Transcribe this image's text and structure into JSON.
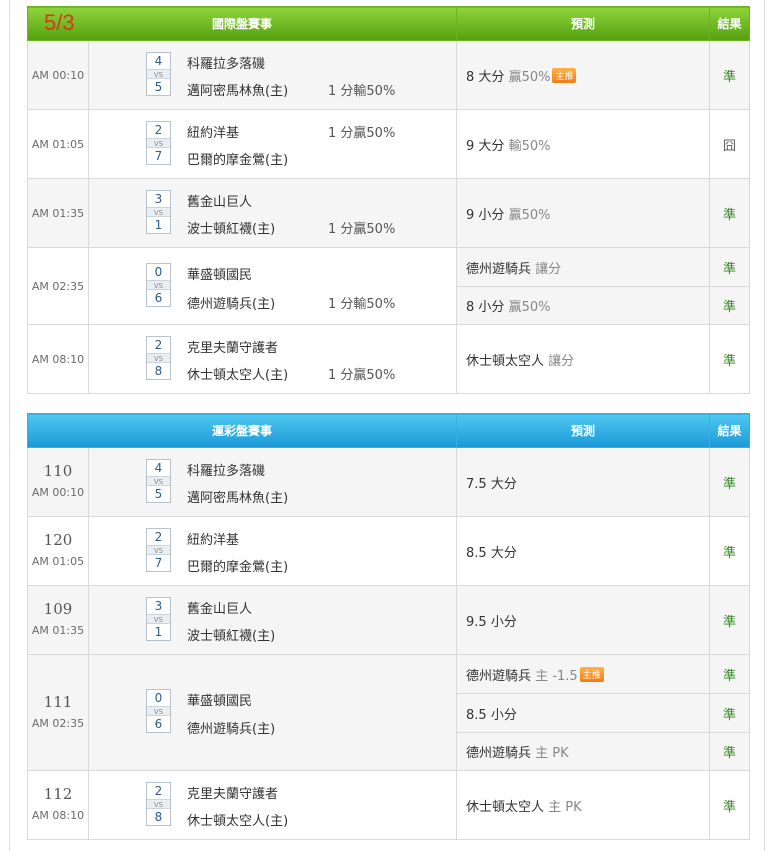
{
  "date": "5/3",
  "colors": {
    "green_header": "#6cb31f",
    "blue_header": "#1b98d8",
    "win": "#2f8a1f",
    "date": "#d13b1b",
    "tag": "#f07d16"
  },
  "table1": {
    "headers": {
      "event": "國際盤賽事",
      "pred": "預測",
      "result": "結果"
    },
    "rows": [
      {
        "time": "AM 00:10",
        "s1": "4",
        "s2": "5",
        "t1": "科羅拉多落磯",
        "t2": "邁阿密馬林魚(主)",
        "line": "1 分輸50%",
        "line_row": 2,
        "preds": [
          {
            "main": "8 大分",
            "sub": "贏50%",
            "tag": "主推",
            "result": "準"
          }
        ]
      },
      {
        "time": "AM 01:05",
        "s1": "2",
        "s2": "7",
        "t1": "紐約洋基",
        "t2": "巴爾的摩金鶯(主)",
        "line": "1 分贏50%",
        "line_row": 1,
        "preds": [
          {
            "main": "9 大分",
            "sub": "輸50%",
            "tag": "",
            "result": "囧"
          }
        ]
      },
      {
        "time": "AM 01:35",
        "s1": "3",
        "s2": "1",
        "t1": "舊金山巨人",
        "t2": "波士頓紅襪(主)",
        "line": "1 分贏50%",
        "line_row": 2,
        "preds": [
          {
            "main": "9 小分",
            "sub": "贏50%",
            "tag": "",
            "result": "準"
          }
        ]
      },
      {
        "time": "AM 02:35",
        "s1": "0",
        "s2": "6",
        "t1": "華盛頓國民",
        "t2": "德州遊騎兵(主)",
        "line": "1 分輸50%",
        "line_row": 2,
        "preds": [
          {
            "main": "德州遊騎兵",
            "sub": "讓分",
            "tag": "",
            "result": "準"
          },
          {
            "main": "8 小分",
            "sub": "贏50%",
            "tag": "",
            "result": "準"
          }
        ]
      },
      {
        "time": "AM 08:10",
        "s1": "2",
        "s2": "8",
        "t1": "克里夫蘭守護者",
        "t2": "休士頓太空人(主)",
        "line": "1 分贏50%",
        "line_row": 2,
        "preds": [
          {
            "main": "休士頓太空人",
            "sub": "讓分",
            "tag": "",
            "result": "準"
          }
        ]
      }
    ]
  },
  "table2": {
    "headers": {
      "event": "運彩盤賽事",
      "pred": "預測",
      "result": "結果"
    },
    "rows": [
      {
        "gid": "110",
        "time": "AM 00:10",
        "s1": "4",
        "s2": "5",
        "t1": "科羅拉多落磯",
        "t2": "邁阿密馬林魚(主)",
        "preds": [
          {
            "main": "7.5 大分",
            "sub": "",
            "tag": "",
            "result": "準"
          }
        ]
      },
      {
        "gid": "120",
        "time": "AM 01:05",
        "s1": "2",
        "s2": "7",
        "t1": "紐約洋基",
        "t2": "巴爾的摩金鶯(主)",
        "preds": [
          {
            "main": "8.5 大分",
            "sub": "",
            "tag": "",
            "result": "準"
          }
        ]
      },
      {
        "gid": "109",
        "time": "AM 01:35",
        "s1": "3",
        "s2": "1",
        "t1": "舊金山巨人",
        "t2": "波士頓紅襪(主)",
        "preds": [
          {
            "main": "9.5 小分",
            "sub": "",
            "tag": "",
            "result": "準"
          }
        ]
      },
      {
        "gid": "111",
        "time": "AM 02:35",
        "s1": "0",
        "s2": "6",
        "t1": "華盛頓國民",
        "t2": "德州遊騎兵(主)",
        "preds": [
          {
            "main": "德州遊騎兵",
            "sub": "主 -1.5",
            "tag": "主推",
            "result": "準"
          },
          {
            "main": "8.5 小分",
            "sub": "",
            "tag": "",
            "result": "準"
          },
          {
            "main": "德州遊騎兵",
            "sub": "主 PK",
            "tag": "",
            "result": "準"
          }
        ]
      },
      {
        "gid": "112",
        "time": "AM 08:10",
        "s1": "2",
        "s2": "8",
        "t1": "克里夫蘭守護者",
        "t2": "休士頓太空人(主)",
        "preds": [
          {
            "main": "休士頓太空人",
            "sub": "主 PK",
            "tag": "",
            "result": "準"
          }
        ]
      }
    ]
  }
}
